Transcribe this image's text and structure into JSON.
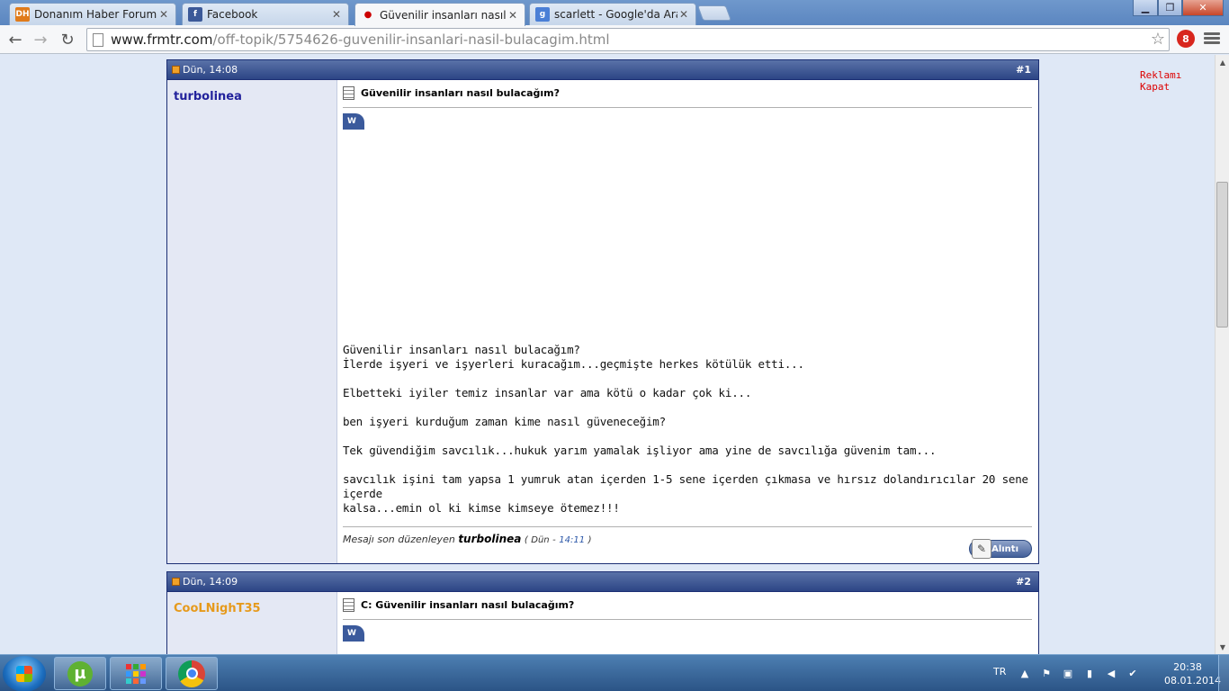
{
  "browser": {
    "tabs": [
      {
        "title": "Donanım Haber Forum",
        "favicon": "DH",
        "favicon_color": "#e07b1b",
        "active": false
      },
      {
        "title": "Facebook",
        "favicon": "f",
        "favicon_color": "#3b5998",
        "active": false
      },
      {
        "title": "Güvenilir insanları nasıl bu",
        "favicon": "●",
        "favicon_color": "#cc0000",
        "active": true
      },
      {
        "title": "scarlett - Google'da Ara",
        "favicon": "g",
        "favicon_color": "#4a7fd6",
        "active": false
      }
    ],
    "url_host": "www.frmtr.com",
    "url_path": "/off-topik/5754626-guvenilir-insanlari-nasil-bulacagim.html",
    "ext_badge": "8"
  },
  "page": {
    "ad_close": "Reklamı Kapat",
    "posts": [
      {
        "date": "Dün, 14:08",
        "number": "#1",
        "username": "turbolinea",
        "title": "Güvenilir insanları nasıl bulacağım?",
        "badge": "W",
        "lines": [
          "Güvenilir insanları nasıl bulacağım?",
          "İlerde işyeri ve işyerleri kuracağım...geçmişte herkes kötülük etti...",
          "",
          "Elbetteki iyiler temiz insanlar var ama kötü o kadar çok ki...",
          "",
          "ben işyeri kurduğum zaman kime nasıl güveneceğim?",
          "",
          "Tek güvendiğim savcılık...hukuk yarım yamalak işliyor ama yine de savcılığa güvenim tam...",
          "",
          "savcılık işini tam yapsa 1 yumruk atan içerden 1-5 sene içerden çıkmasa ve hırsız dolandırıcılar 20 sene içerde",
          "kalsa...emin ol ki kimse kimseye ötemez!!!"
        ],
        "edited_prefix": "Mesajı son düzenleyen",
        "edited_by": "turbolinea",
        "edited_day": "Dün",
        "edited_time": "14:11",
        "quote_label": "Alıntı"
      },
      {
        "date": "Dün, 14:09",
        "number": "#2",
        "username": "CooLNighT35",
        "title": "C: Güvenilir insanları nasıl bulacağım?",
        "badge": "W"
      }
    ]
  },
  "taskbar": {
    "language": "TR",
    "time": "20:38",
    "date": "08.01.2014"
  },
  "colors": {
    "post_header": "#2c4585",
    "username_blue": "#22229c",
    "username_orange": "#e69a1c",
    "accent_link": "#2a56a8"
  }
}
